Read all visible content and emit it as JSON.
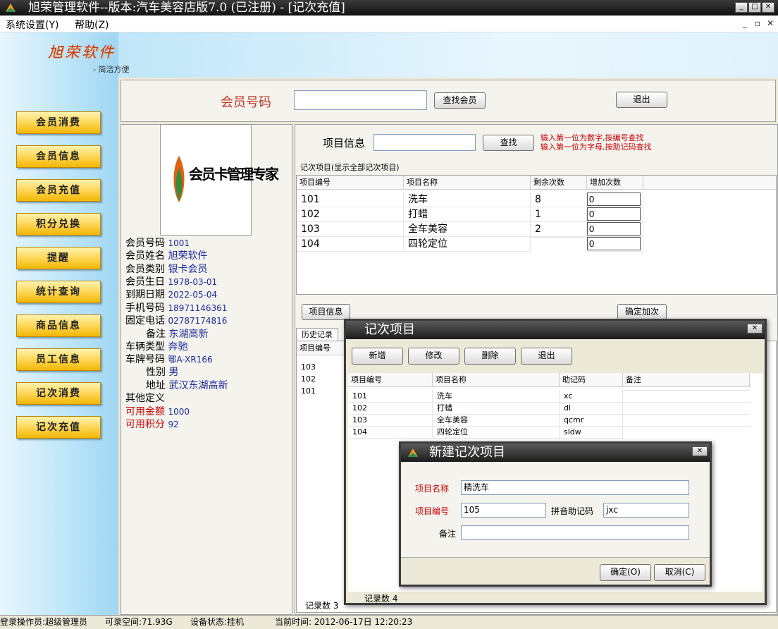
{
  "window": {
    "title": "旭荣管理软件--版本:汽车美容店版7.0 (已注册) - [记次充值]"
  },
  "menu": {
    "items": [
      "系统设置(Y)",
      "帮助(Z)"
    ]
  },
  "logo": {
    "name": "旭荣软件",
    "slogan": "- 简洁方便",
    "card_text": "会员卡管理专家"
  },
  "nav": [
    "会员消费",
    "会员信息",
    "会员充值",
    "积分兑换",
    "提醒",
    "统计查询",
    "商品信息",
    "员工信息",
    "记次消费",
    "记次充值"
  ],
  "search": {
    "label": "会员号码",
    "value": "",
    "find_button": "查找会员",
    "exit_button": "退出"
  },
  "member": {
    "rows": [
      {
        "label": "会员号码",
        "value": "1001"
      },
      {
        "label": "会员姓名",
        "value": "旭荣软件"
      },
      {
        "label": "会员类别",
        "value": "银卡会员"
      },
      {
        "label": "会员生日",
        "value": "1978-03-01"
      },
      {
        "label": "到期日期",
        "value": "2022-05-04"
      },
      {
        "label": "手机号码",
        "value": "18971146361"
      },
      {
        "label": "固定电话",
        "value": "02787174816"
      },
      {
        "label": "备注",
        "value": "东湖高新"
      },
      {
        "label": "车辆类型",
        "value": "奔驰"
      },
      {
        "label": "车牌号码",
        "value": "鄂A-XR166"
      },
      {
        "label": "性别",
        "value": "男"
      },
      {
        "label": "地址",
        "value": "武汉东湖高新"
      },
      {
        "label": "其他定义",
        "value": ""
      },
      {
        "label": "可用金额",
        "value": "1000"
      },
      {
        "label": "可用积分",
        "value": "92"
      }
    ]
  },
  "project_search": {
    "label": "项目信息",
    "value": "",
    "find_button": "查找",
    "hint1": "输入第一位为数字,按编号查找",
    "hint2": "输入第一位为字母,按助记码查找"
  },
  "count_items": {
    "group_title": "记次项目(显示全部记次项目)",
    "headers": [
      "项目编号",
      "项目名称",
      "剩余次数",
      "增加次数"
    ],
    "rows": [
      {
        "id": "101",
        "name": "洗车",
        "remaining": "8",
        "add": "0"
      },
      {
        "id": "102",
        "name": "打蜡",
        "remaining": "1",
        "add": "0"
      },
      {
        "id": "103",
        "name": "全车美容",
        "remaining": "2",
        "add": "0"
      },
      {
        "id": "104",
        "name": "四轮定位",
        "remaining": "",
        "add": "0"
      }
    ]
  },
  "actions": {
    "project_info": "项目信息",
    "confirm_add": "确定加次"
  },
  "history": {
    "tab": "历史记录",
    "header": "项目编号",
    "rows": [
      "103",
      "102",
      "101"
    ],
    "record_count": "记录数 3"
  },
  "dialog_items": {
    "title": "记次项目",
    "buttons": {
      "add": "新增",
      "edit": "修改",
      "delete": "删除",
      "exit": "退出"
    },
    "headers": [
      "项目编号",
      "项目名称",
      "助记码",
      "备注"
    ],
    "rows": [
      {
        "id": "101",
        "name": "洗车",
        "code": "xc",
        "note": ""
      },
      {
        "id": "102",
        "name": "打蜡",
        "code": "dl",
        "note": ""
      },
      {
        "id": "103",
        "name": "全车美容",
        "code": "qcmr",
        "note": ""
      },
      {
        "id": "104",
        "name": "四轮定位",
        "code": "sldw",
        "note": ""
      }
    ],
    "record_count": "记录数 4"
  },
  "dialog_new": {
    "title": "新建记次项目",
    "name_label": "项目名称",
    "name_value": "精洗车",
    "id_label": "项目编号",
    "id_value": "105",
    "code_label": "拼音助记码",
    "code_value": "jxc",
    "note_label": "备注",
    "note_value": "",
    "ok": "确定(O)",
    "cancel": "取消(C)"
  },
  "status": {
    "operator": "登录操作员:超级管理员",
    "space": "可录空间:71.93G",
    "device": "设备状态:挂机",
    "time": "当前时间: 2012-06-17日 12:20:23"
  }
}
